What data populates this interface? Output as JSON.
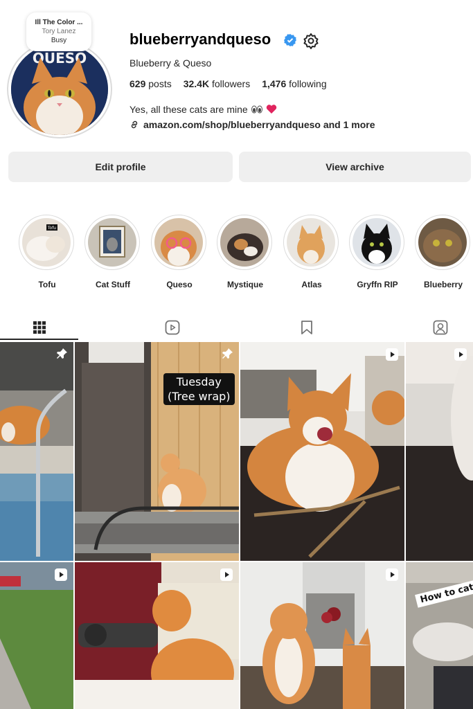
{
  "note": {
    "line1": "Ill The Color ...",
    "line2": "Tory Lanez",
    "line3": "Busy"
  },
  "profile": {
    "username": "blueberryandqueso",
    "display_name": "Blueberry & Queso",
    "posts_count": "629",
    "posts_label": "posts",
    "followers_count": "32.4K",
    "followers_label": "followers",
    "following_count": "1,476",
    "following_label": "following",
    "bio": "Yes, all these cats are mine",
    "link": "amazon.com/shop/blueberryandqueso and 1 more",
    "avatar_text": "QUESO"
  },
  "buttons": {
    "edit": "Edit profile",
    "archive": "View archive"
  },
  "highlights": [
    {
      "label": "Tofu",
      "tag": "Tofu"
    },
    {
      "label": "Cat Stuff"
    },
    {
      "label": "Queso"
    },
    {
      "label": "Mystique"
    },
    {
      "label": "Atlas"
    },
    {
      "label": "Gryffn RIP"
    },
    {
      "label": "Blueberry"
    }
  ],
  "tabs": [
    "posts-grid-icon",
    "reels-icon",
    "saved-icon",
    "tagged-icon"
  ],
  "posts": [
    {
      "type": "pinned"
    },
    {
      "type": "pinned",
      "caption_line1": "Tuesday",
      "caption_line2": "(Tree wrap)"
    },
    {
      "type": "reel"
    },
    {
      "type": "reel"
    },
    {
      "type": "reel"
    },
    {
      "type": "reel"
    },
    {
      "type": "reel"
    },
    {
      "type": "reel",
      "caption": "How to cat"
    }
  ],
  "colors": {
    "accent_blue": "#0095f6",
    "verified_blue": "#3897f0",
    "heart": "#e0245e",
    "button_bg": "#efefef"
  }
}
